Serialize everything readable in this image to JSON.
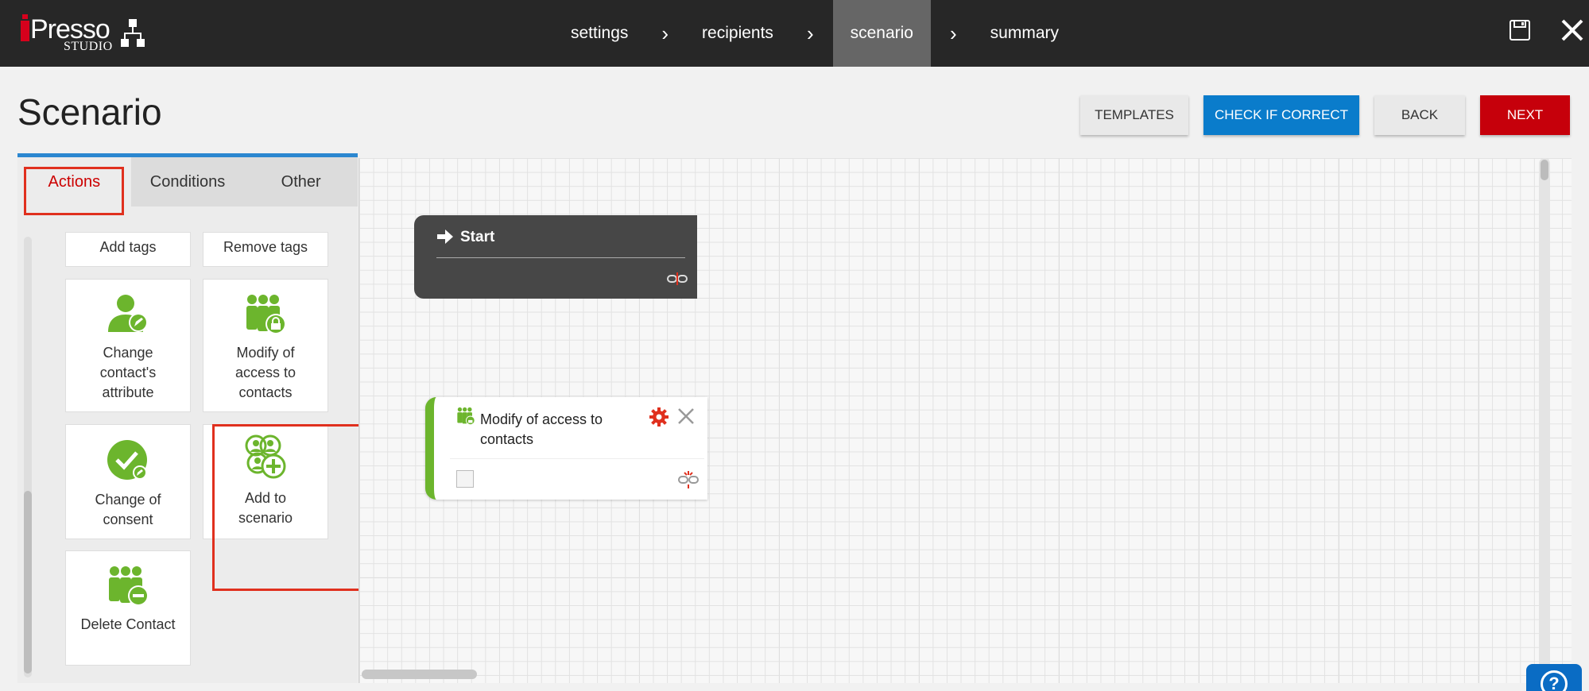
{
  "app": {
    "logo_main": "Presso",
    "logo_sub": "STUDIO"
  },
  "steps": [
    {
      "label": "settings",
      "active": false
    },
    {
      "label": "recipients",
      "active": false
    },
    {
      "label": "scenario",
      "active": true
    },
    {
      "label": "summary",
      "active": false
    }
  ],
  "header": {
    "title": "Scenario",
    "templates_label": "TEMPLATES",
    "check_label": "CHECK IF CORRECT",
    "back_label": "BACK",
    "next_label": "NEXT"
  },
  "panel": {
    "tabs": [
      {
        "label": "Actions",
        "active": true
      },
      {
        "label": "Conditions",
        "active": false
      },
      {
        "label": "Other",
        "active": false
      }
    ],
    "tiles": {
      "add_tags": "Add tags",
      "remove_tags": "Remove tags",
      "change_attribute": "Change contact's attribute",
      "modify_access": "Modify of access to contacts",
      "change_consent": "Change of consent",
      "add_to_scenario": "Add to scenario",
      "delete_contact": "Delete Contact"
    }
  },
  "canvas": {
    "start_node": {
      "title": "Start"
    },
    "action_node": {
      "title": "Modify of access to contacts"
    }
  },
  "colors": {
    "accent_blue": "#0a7ccb",
    "next_red": "#c6000b",
    "action_green": "#6cb52d",
    "highlight": "#e0301e"
  },
  "help": {
    "symbol": "?"
  }
}
